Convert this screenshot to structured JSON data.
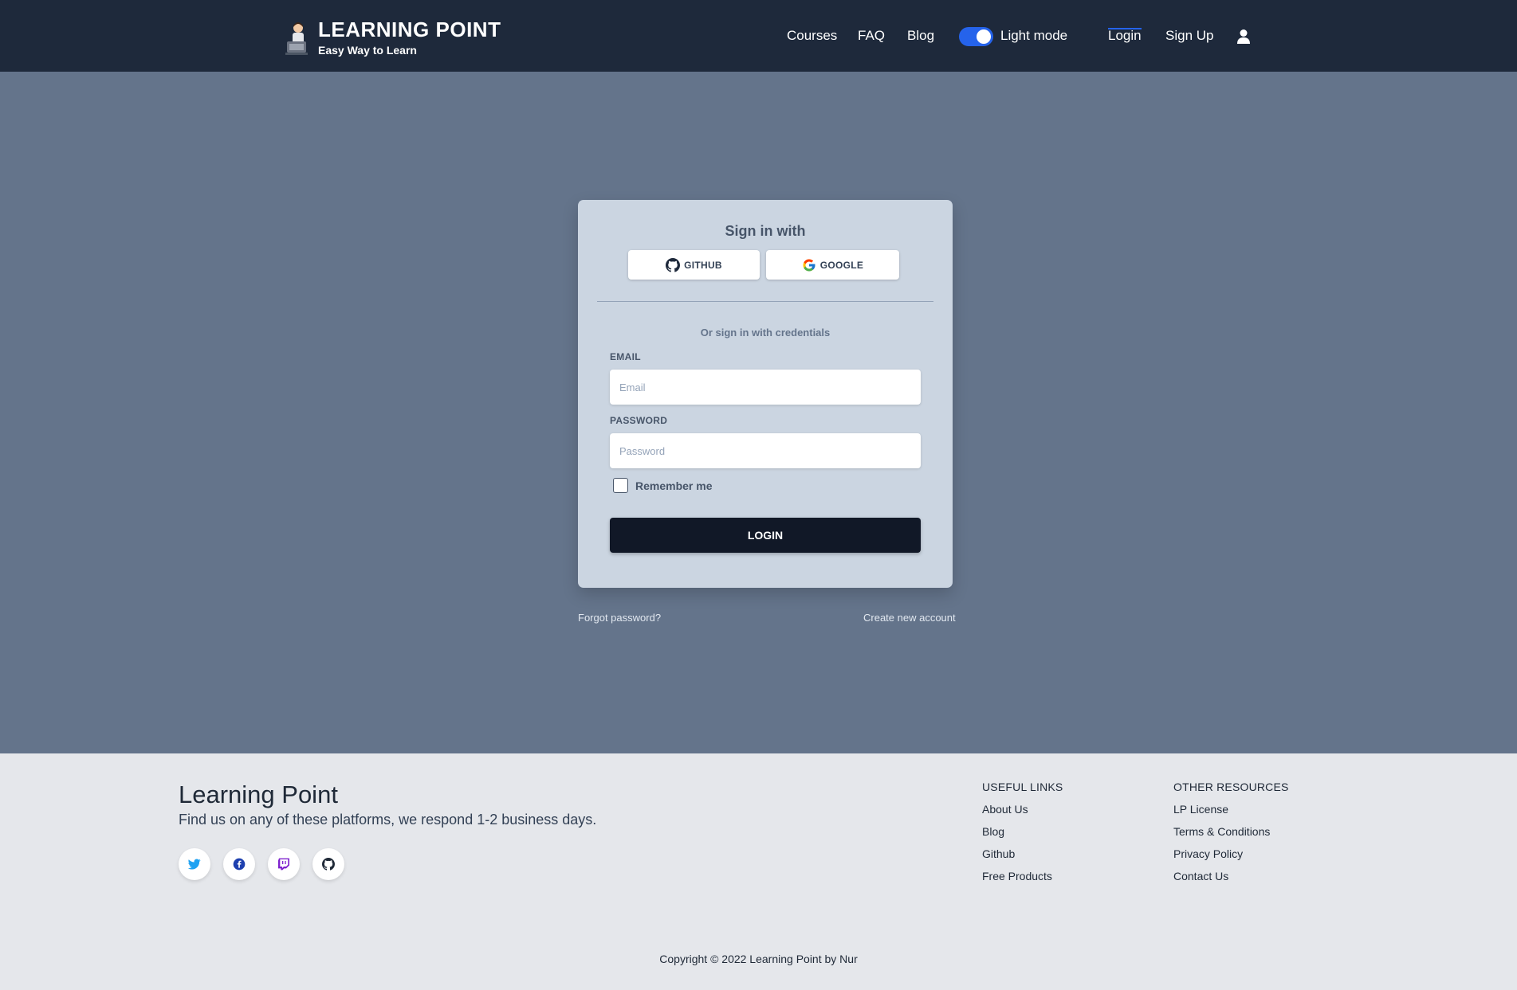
{
  "nav": {
    "brand_title": "LEARNING POINT",
    "brand_subtitle": "Easy Way to Learn",
    "links": {
      "courses": "Courses",
      "faq": "FAQ",
      "blog": "Blog",
      "theme_toggle": "Light mode",
      "login": "Login",
      "signup": "Sign Up"
    },
    "theme_toggle_on": true,
    "active_link": "Login",
    "accent": "#2563eb"
  },
  "signin": {
    "title": "Sign in with",
    "github_label": "GITHUB",
    "google_label": "GOOGLE",
    "divider_text": "Or sign in with credentials",
    "email_label": "EMAIL",
    "email_placeholder": "Email",
    "password_label": "PASSWORD",
    "password_placeholder": "Password",
    "remember_label": "Remember me",
    "remember_checked": false,
    "login_button": "LOGIN"
  },
  "links_below": {
    "forgot": "Forgot password?",
    "create": "Create new account"
  },
  "footer": {
    "title": "Learning Point",
    "subtitle": "Find us on any of these platforms, we respond 1-2 business days.",
    "social_icons": [
      "twitter-icon",
      "facebook-icon",
      "twitch-icon",
      "github-icon"
    ],
    "useful_links": {
      "heading": "USEFUL LINKS",
      "items": [
        "About Us",
        "Blog",
        "Github",
        "Free Products"
      ]
    },
    "other_resources": {
      "heading": "OTHER RESOURCES",
      "items": [
        "LP License",
        "Terms & Conditions",
        "Privacy Policy",
        "Contact Us"
      ]
    },
    "copyright": "Copyright © 2022 Learning Point by Nur"
  }
}
